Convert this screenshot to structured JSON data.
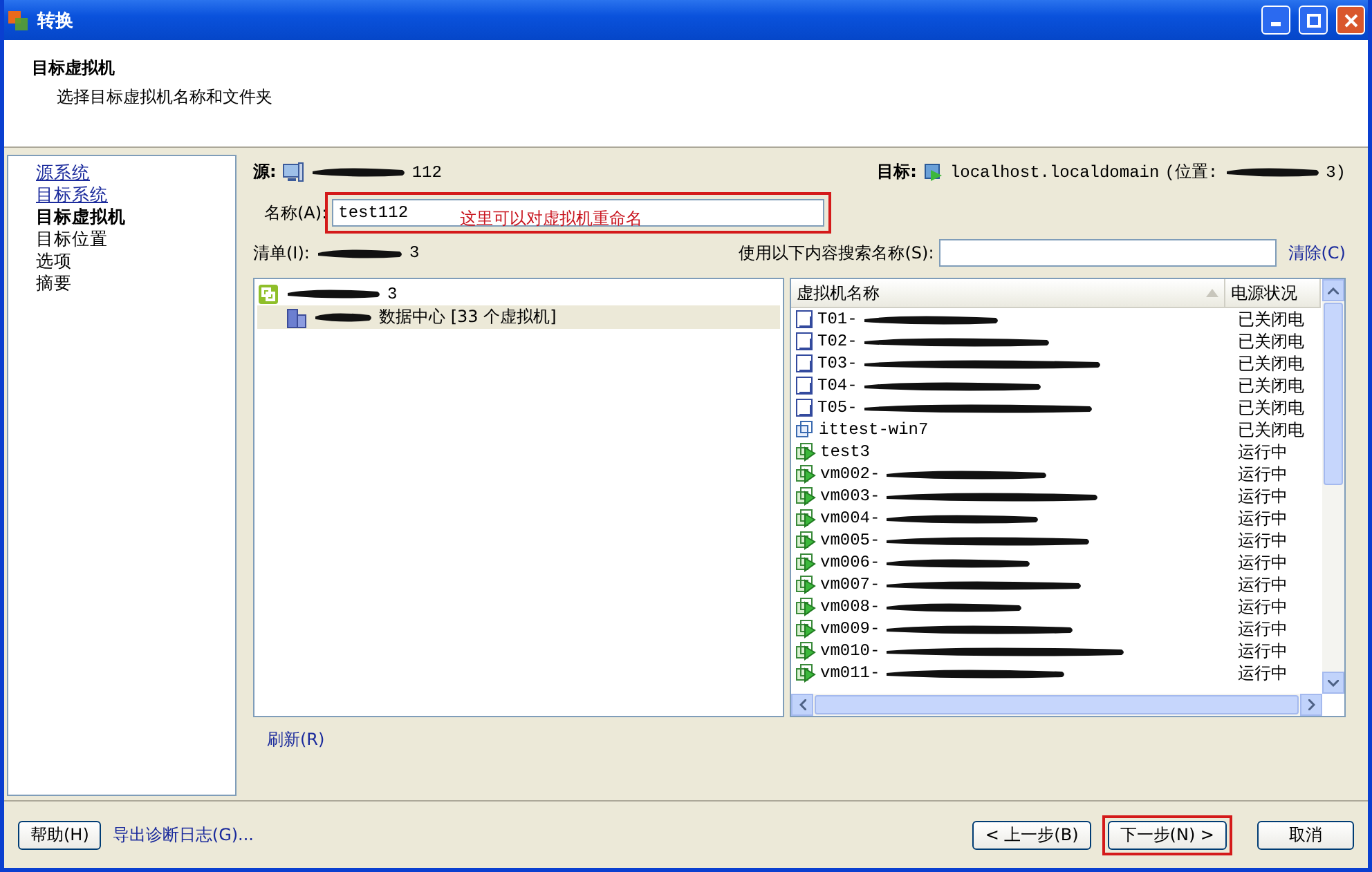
{
  "window": {
    "title": "转换"
  },
  "header": {
    "title": "目标虚拟机",
    "subtitle": "选择目标虚拟机名称和文件夹"
  },
  "steps": [
    {
      "label": "源系统",
      "kind": "link"
    },
    {
      "label": "目标系统",
      "kind": "link"
    },
    {
      "label": "目标虚拟机",
      "kind": "current"
    },
    {
      "label": "目标位置",
      "kind": "plain"
    },
    {
      "label": "选项",
      "kind": "plain"
    },
    {
      "label": "摘要",
      "kind": "plain"
    }
  ],
  "source": {
    "label": "源:",
    "value": "112",
    "redacted": true
  },
  "target": {
    "label": "目标:",
    "host": "localhost.localdomain",
    "location_label": "(位置:",
    "location_suffix": "3)",
    "redacted": true
  },
  "name_field": {
    "label": "名称(A):",
    "value": "test112",
    "highlighted": true,
    "note": "这里可以对虚拟机重命名"
  },
  "inventory": {
    "label": "清单(I):",
    "value": "3",
    "redacted": true
  },
  "search": {
    "label": "使用以下内容搜索名称(S):",
    "clear": "清除(C)"
  },
  "tree": [
    {
      "label": "3",
      "kind": "vcenter",
      "redacted": true,
      "selected": false,
      "children": [
        {
          "label": "数据中心 [33 个虚拟机]",
          "kind": "datacenter",
          "redacted": true,
          "selected": true
        }
      ]
    }
  ],
  "vm_table": {
    "columns": [
      {
        "label": "虚拟机名称",
        "sorted": true
      },
      {
        "label": "电源状况",
        "sorted": false
      }
    ],
    "rows": [
      {
        "name": "T01-",
        "kind": "template",
        "redacted": true,
        "status": "已关闭电"
      },
      {
        "name": "T02-",
        "kind": "template",
        "redacted": true,
        "status": "已关闭电"
      },
      {
        "name": "T03-",
        "kind": "template",
        "redacted": true,
        "status": "已关闭电"
      },
      {
        "name": "T04-",
        "kind": "template",
        "redacted": true,
        "status": "已关闭电"
      },
      {
        "name": "T05-",
        "kind": "template",
        "redacted": true,
        "status": "已关闭电"
      },
      {
        "name": "ittest-win7",
        "kind": "off",
        "redacted": false,
        "status": "已关闭电"
      },
      {
        "name": "test3",
        "kind": "on",
        "redacted": false,
        "status": "运行中"
      },
      {
        "name": "vm002-",
        "kind": "on",
        "redacted": true,
        "status": "运行中"
      },
      {
        "name": "vm003-",
        "kind": "on",
        "redacted": true,
        "status": "运行中"
      },
      {
        "name": "vm004-",
        "kind": "on",
        "redacted": true,
        "status": "运行中"
      },
      {
        "name": "vm005-",
        "kind": "on",
        "redacted": true,
        "status": "运行中"
      },
      {
        "name": "vm006-",
        "kind": "on",
        "redacted": true,
        "status": "运行中"
      },
      {
        "name": "vm007-",
        "kind": "on",
        "redacted": true,
        "status": "运行中"
      },
      {
        "name": "vm008-",
        "kind": "on",
        "redacted": true,
        "status": "运行中"
      },
      {
        "name": "vm009-",
        "kind": "on",
        "redacted": true,
        "status": "运行中"
      },
      {
        "name": "vm010-",
        "kind": "on",
        "redacted": true,
        "status": "运行中"
      },
      {
        "name": "vm011-",
        "kind": "on",
        "redacted": true,
        "status": "运行中"
      }
    ]
  },
  "refresh": "刷新(R)",
  "footer": {
    "help": "帮助(H)",
    "export": "导出诊断日志(G)...",
    "back": "< 上一步(B)",
    "next": {
      "label": "下一步(N) >",
      "highlighted": true
    },
    "cancel": "取消"
  }
}
